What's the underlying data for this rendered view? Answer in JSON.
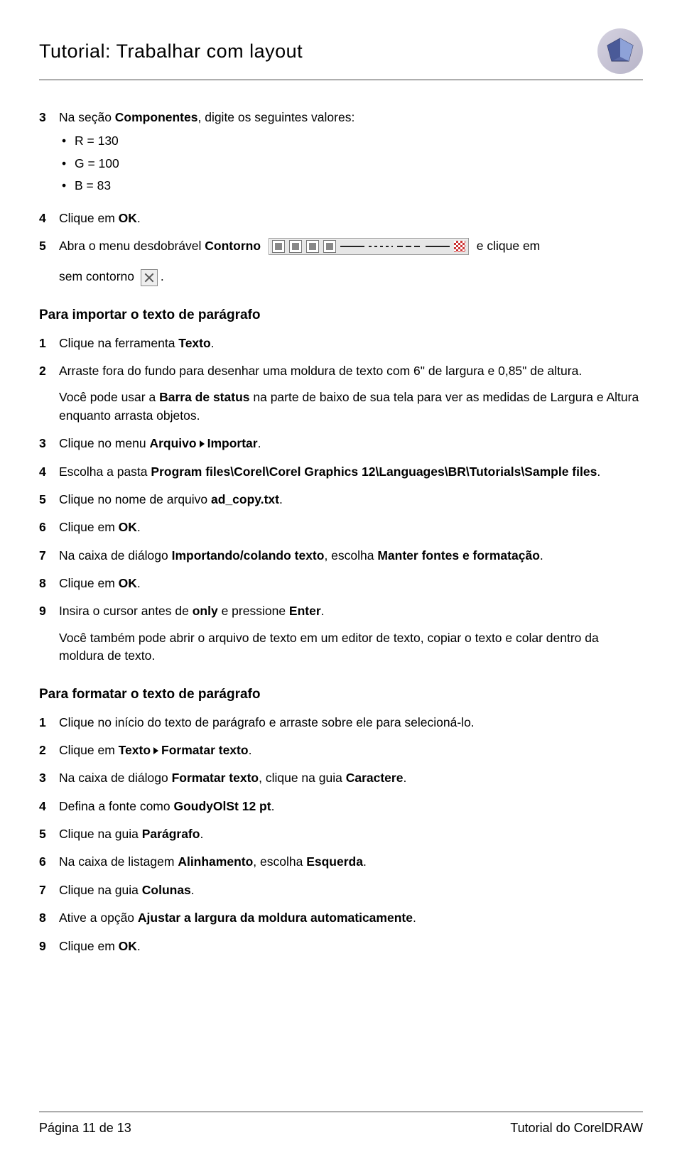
{
  "header": {
    "title": "Tutorial: Trabalhar com layout"
  },
  "section1": {
    "s3": {
      "pre": "Na seção ",
      "b1": "Componentes",
      "post": ", digite os seguintes valores:",
      "items": [
        "R = 130",
        "G = 100",
        "B = 83"
      ]
    },
    "s4": {
      "pre": "Clique em ",
      "b1": "OK",
      "post": "."
    },
    "s5": {
      "pre": "Abra o menu desdobrável ",
      "b1": "Contorno",
      "mid": " e clique em",
      "line2_pre": "sem contorno ",
      "line2_post": "."
    }
  },
  "importHeading": "Para importar o texto de parágrafo",
  "import": {
    "s1": {
      "pre": "Clique na ferramenta ",
      "b1": "Texto",
      "post": "."
    },
    "s2": {
      "text": "Arraste fora do fundo para desenhar uma moldura de texto com 6\" de largura e 0,85\" de altura.",
      "note_pre": "Você pode usar a ",
      "note_b": "Barra de status",
      "note_post": " na parte de baixo de sua tela para ver as medidas de Largura e Altura enquanto arrasta objetos."
    },
    "s3": {
      "pre": "Clique no menu ",
      "b1": "Arquivo",
      "b2": "Importar",
      "post": "."
    },
    "s4": {
      "pre": "Escolha a pasta ",
      "b1": "Program files\\Corel\\Corel Graphics 12\\Languages\\BR\\Tutorials\\Sample files",
      "post": "."
    },
    "s5": {
      "pre": "Clique no nome de arquivo ",
      "b1": "ad_copy.txt",
      "post": "."
    },
    "s6": {
      "pre": "Clique em ",
      "b1": "OK",
      "post": "."
    },
    "s7": {
      "pre": "Na caixa de diálogo ",
      "b1": "Importando/colando texto",
      "mid": ", escolha ",
      "b2": "Manter fontes e formatação",
      "post": "."
    },
    "s8": {
      "pre": "Clique em ",
      "b1": "OK",
      "post": "."
    },
    "s9": {
      "pre": "Insira o cursor antes de ",
      "b1": "only",
      "mid": " e pressione ",
      "b2": "Enter",
      "post": ".",
      "note": "Você também pode abrir o arquivo de texto em um editor de texto, copiar o texto e colar dentro da moldura de texto."
    }
  },
  "formatHeading": "Para formatar o texto de parágrafo",
  "format": {
    "s1": "Clique no início do texto de parágrafo e arraste sobre ele para selecioná-lo.",
    "s2": {
      "pre": "Clique em ",
      "b1": "Texto",
      "b2": "Formatar texto",
      "post": "."
    },
    "s3": {
      "pre": "Na caixa de diálogo ",
      "b1": "Formatar texto",
      "mid": ", clique na guia ",
      "b2": "Caractere",
      "post": "."
    },
    "s4": {
      "pre": "Defina a fonte como ",
      "b1": "GoudyOlSt 12 pt",
      "post": "."
    },
    "s5": {
      "pre": "Clique na guia ",
      "b1": "Parágrafo",
      "post": "."
    },
    "s6": {
      "pre": "Na caixa de listagem ",
      "b1": "Alinhamento",
      "mid": ", escolha ",
      "b2": "Esquerda",
      "post": "."
    },
    "s7": {
      "pre": "Clique na guia ",
      "b1": "Colunas",
      "post": "."
    },
    "s8": {
      "pre": "Ative a opção ",
      "b1": "Ajustar a largura da moldura automaticamente",
      "post": "."
    },
    "s9": {
      "pre": "Clique em ",
      "b1": "OK",
      "post": "."
    }
  },
  "footer": {
    "left": "Página 11 de 13",
    "right": "Tutorial do CorelDRAW"
  }
}
